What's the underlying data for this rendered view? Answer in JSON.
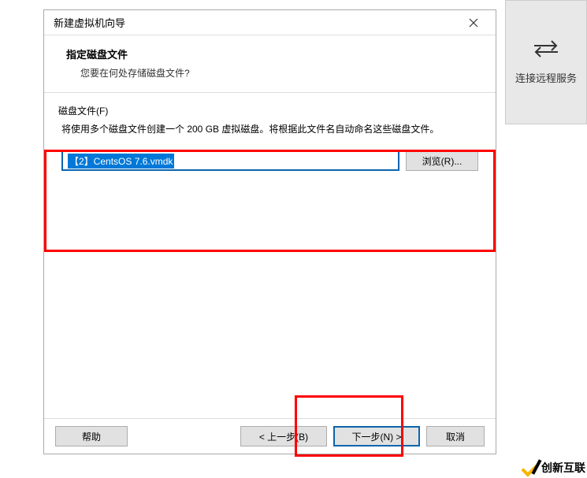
{
  "dialog": {
    "title": "新建虚拟机向导",
    "header_title": "指定磁盘文件",
    "header_subtitle": "您要在何处存储磁盘文件?",
    "group_label": "磁盘文件(F)",
    "group_desc": "将使用多个磁盘文件创建一个 200 GB 虚拟磁盘。将根据此文件名自动命名这些磁盘文件。",
    "file_value": "【2】CentsOS 7.6.vmdk",
    "browse_label": "浏览(R)...",
    "help_label": "帮助",
    "back_label": "< 上一步(B)",
    "next_label": "下一步(N) >",
    "cancel_label": "取消"
  },
  "side": {
    "label": "连接远程服务"
  },
  "brand": "创新互联"
}
